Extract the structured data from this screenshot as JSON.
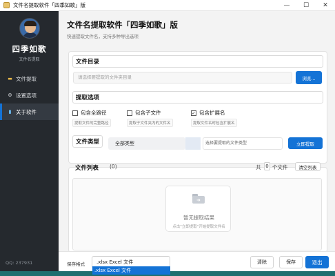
{
  "window": {
    "title": "文件名提取软件「四季如歌」版",
    "controls": {
      "minimize": "—",
      "maximize": "☐",
      "close": "✕"
    }
  },
  "sidebar": {
    "brand": "四季如歌",
    "subtitle": "文件名提取",
    "items": [
      {
        "label": "文件提取",
        "icon": "folder-icon"
      },
      {
        "label": "设置选项",
        "icon": "gear-icon"
      },
      {
        "label": "关于软件",
        "icon": "info-icon",
        "active": true
      }
    ],
    "footer": "QQ: 237931"
  },
  "header": {
    "title": "文件名提取软件「四季如歌」版",
    "subtitle": "快速提取文件名，支持多种导出选项"
  },
  "directory": {
    "section": "文件目录",
    "placeholder": "请选择要提取的文件夹目录",
    "browse": "浏览..."
  },
  "options": {
    "section": "提取选项",
    "items": [
      {
        "label": "包含全路径",
        "desc": "提取文件的完整路径",
        "checked": false
      },
      {
        "label": "包含子文件",
        "desc": "提取子文件夹内的文件名",
        "checked": false
      },
      {
        "label": "包含扩展名",
        "desc": "提取文件名时包含扩展名",
        "checked": true
      }
    ]
  },
  "filetype": {
    "section": "文件类型",
    "selected": "全部类型",
    "placeholder": "选择要提取的文件类型",
    "extract": "立即提取"
  },
  "filelist": {
    "section": "文件列表",
    "count_paren": "(0)",
    "total_prefix": "共",
    "total": "0",
    "total_suffix": "个文件",
    "clear": "清空列表",
    "empty_title": "暂无提取结果",
    "empty_hint": "点击\"立即提取\"开始提取文件名"
  },
  "bottom": {
    "save_label": "保存格式",
    "format": ".xlsx Excel 文件",
    "dropdown_option": ".xlsx Excel 文件",
    "clear": "清除",
    "save": "保存",
    "exit": "退出"
  },
  "colors": {
    "accent": "#1473d6",
    "sidebar": "#25292e"
  }
}
